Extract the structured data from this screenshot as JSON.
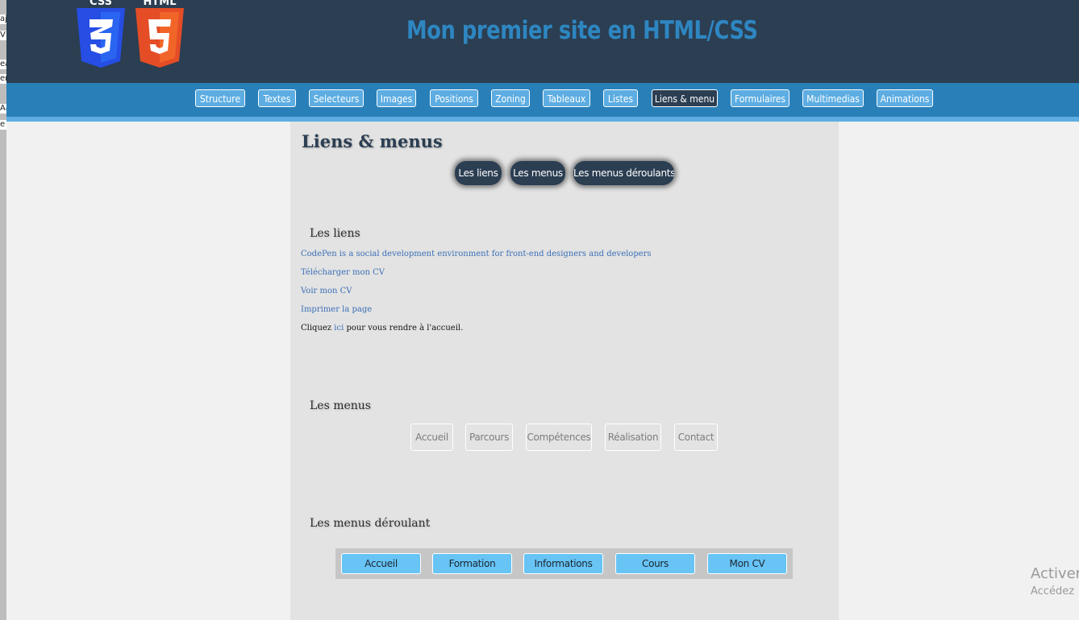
{
  "background_window": {
    "fragments": [
      "aj",
      "V",
      "ea",
      "en",
      "Aa",
      "e"
    ]
  },
  "header": {
    "logos": [
      {
        "name": "css3-logo",
        "label": "CSS",
        "digit": "3",
        "color": "#264de4"
      },
      {
        "name": "html5-logo",
        "label": "HTML",
        "digit": "5",
        "color": "#e44d26"
      }
    ],
    "title": "Mon premier site en HTML/CSS"
  },
  "nav": {
    "items": [
      {
        "label": "Structure"
      },
      {
        "label": "Textes"
      },
      {
        "label": "Selecteurs"
      },
      {
        "label": "Images"
      },
      {
        "label": "Positions"
      },
      {
        "label": "Zoning"
      },
      {
        "label": "Tableaux"
      },
      {
        "label": "Listes"
      },
      {
        "label": "Liens & menu",
        "active": true
      },
      {
        "label": "Formulaires"
      },
      {
        "label": "Multimedias"
      },
      {
        "label": "Animations"
      }
    ]
  },
  "main": {
    "title": "Liens & menus",
    "anchors": [
      "Les liens",
      "Les menus",
      "Les menus déroulants"
    ],
    "links_section": {
      "title": "Les liens",
      "links": [
        "CodePen is a social development environment for front-end designers and developers",
        "Télécharger mon CV",
        "Voir mon CV",
        "Imprimer la page"
      ],
      "sentence_before": "Cliquez ",
      "sentence_link": "ici",
      "sentence_after": " pour vous rendre à l'accueil."
    },
    "menus_section": {
      "title": "Les menus",
      "items": [
        "Accueil",
        "Parcours",
        "Compétences",
        "Réalisation",
        "Contact"
      ]
    },
    "dropdown_section": {
      "title": "Les menus déroulant",
      "items": [
        "Accueil",
        "Formation",
        "Informations",
        "Cours",
        "Mon CV"
      ]
    }
  },
  "watermark": {
    "line1": "Activer",
    "line2": "Accédez"
  },
  "colors": {
    "header_bg": "#2b3e52",
    "nav_bg": "#2980b9",
    "nav_button": "#5dade2",
    "title_blue": "#2e86c1",
    "dropdown_button": "#67c4f5",
    "content_bg": "#e3e3e3"
  }
}
